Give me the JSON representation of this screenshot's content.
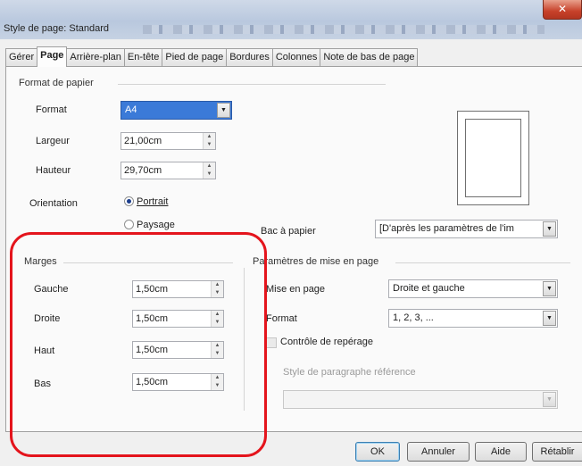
{
  "window": {
    "title": "Style de page: Standard",
    "close_glyph": "✕"
  },
  "tabs": [
    {
      "label": "Gérer",
      "active": false
    },
    {
      "label": "Page",
      "active": true
    },
    {
      "label": "Arrière-plan",
      "active": false
    },
    {
      "label": "En-tête",
      "active": false
    },
    {
      "label": "Pied de page",
      "active": false
    },
    {
      "label": "Bordures",
      "active": false
    },
    {
      "label": "Colonnes",
      "active": false
    },
    {
      "label": "Note de bas de page",
      "active": false
    }
  ],
  "paper": {
    "title": "Format de papier",
    "format_label": "Format",
    "format_value": "A4",
    "width_label": "Largeur",
    "width_value": "21,00cm",
    "height_label": "Hauteur",
    "height_value": "29,70cm",
    "orientation_label": "Orientation",
    "portrait_label": "Portrait",
    "landscape_label": "Paysage",
    "orientation_selected": "portrait",
    "tray_label": "Bac à papier",
    "tray_value": "[D'après les paramètres de l'im"
  },
  "margins": {
    "title": "Marges",
    "left_label": "Gauche",
    "left_value": "1,50cm",
    "right_label": "Droite",
    "right_value": "1,50cm",
    "top_label": "Haut",
    "top_value": "1,50cm",
    "bottom_label": "Bas",
    "bottom_value": "1,50cm"
  },
  "layout": {
    "title": "Paramètres de mise en page",
    "layout_label": "Mise en page",
    "layout_value": "Droite et gauche",
    "format_label": "Format",
    "format_value": "1, 2, 3, ...",
    "register_label": "Contrôle de repérage",
    "ref_style_label": "Style de paragraphe référence",
    "ref_style_value": ""
  },
  "buttons": {
    "ok": "OK",
    "cancel": "Annuler",
    "help": "Aide",
    "reset": "Rétablir"
  },
  "colors": {
    "highlight": "#e4141c",
    "selection": "#3b7ad8"
  }
}
